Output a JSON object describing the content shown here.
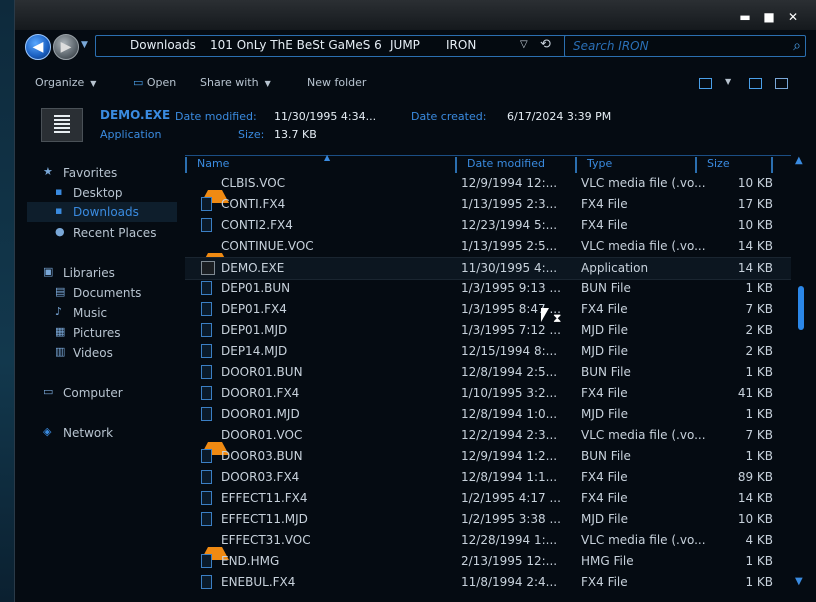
{
  "address": {
    "crumbs": [
      "Downloads",
      "101 OnLy ThE BeSt GaMeS 6",
      "JUMP",
      "IRON"
    ],
    "search_placeholder": "Search IRON"
  },
  "toolbar": {
    "organize": "Organize",
    "open": "Open",
    "share_with": "Share with",
    "new_folder": "New folder"
  },
  "details": {
    "name": "DEMO.EXE",
    "type": "Application",
    "date_modified_label": "Date modified:",
    "date_modified": "11/30/1995 4:34...",
    "date_created_label": "Date created:",
    "date_created": "6/17/2024 3:39 PM",
    "size_label": "Size:",
    "size": "13.7 KB"
  },
  "sidebar": {
    "favorites": "Favorites",
    "desktop": "Desktop",
    "downloads": "Downloads",
    "recent": "Recent Places",
    "libraries": "Libraries",
    "documents": "Documents",
    "music": "Music",
    "pictures": "Pictures",
    "videos": "Videos",
    "computer": "Computer",
    "network": "Network"
  },
  "columns": {
    "name": "Name",
    "date": "Date modified",
    "type": "Type",
    "size": "Size"
  },
  "files": [
    {
      "name": "CLBIS.VOC",
      "date": "12/9/1994 12:...",
      "type": "VLC media file (.vo...",
      "size": "10 KB",
      "icon": "vlc"
    },
    {
      "name": "CONTI.FX4",
      "date": "1/13/1995 2:3...",
      "type": "FX4 File",
      "size": "17 KB",
      "icon": "file"
    },
    {
      "name": "CONTI2.FX4",
      "date": "12/23/1994 5:...",
      "type": "FX4 File",
      "size": "10 KB",
      "icon": "file"
    },
    {
      "name": "CONTINUE.VOC",
      "date": "1/13/1995 2:5...",
      "type": "VLC media file (.vo...",
      "size": "14 KB",
      "icon": "vlc"
    },
    {
      "name": "DEMO.EXE",
      "date": "11/30/1995 4:...",
      "type": "Application",
      "size": "14 KB",
      "icon": "exe"
    },
    {
      "name": "DEP01.BUN",
      "date": "1/3/1995 9:13 ...",
      "type": "BUN File",
      "size": "1 KB",
      "icon": "file"
    },
    {
      "name": "DEP01.FX4",
      "date": "1/3/1995 8:47 ...",
      "type": "FX4 File",
      "size": "7 KB",
      "icon": "file"
    },
    {
      "name": "DEP01.MJD",
      "date": "1/3/1995 7:12 ...",
      "type": "MJD File",
      "size": "2 KB",
      "icon": "file"
    },
    {
      "name": "DEP14.MJD",
      "date": "12/15/1994 8:...",
      "type": "MJD File",
      "size": "2 KB",
      "icon": "file"
    },
    {
      "name": "DOOR01.BUN",
      "date": "12/8/1994 2:5...",
      "type": "BUN File",
      "size": "1 KB",
      "icon": "file"
    },
    {
      "name": "DOOR01.FX4",
      "date": "1/10/1995 3:2...",
      "type": "FX4 File",
      "size": "41 KB",
      "icon": "file"
    },
    {
      "name": "DOOR01.MJD",
      "date": "12/8/1994 1:0...",
      "type": "MJD File",
      "size": "1 KB",
      "icon": "file"
    },
    {
      "name": "DOOR01.VOC",
      "date": "12/2/1994 2:3...",
      "type": "VLC media file (.vo...",
      "size": "7 KB",
      "icon": "vlc"
    },
    {
      "name": "DOOR03.BUN",
      "date": "12/9/1994 1:2...",
      "type": "BUN File",
      "size": "1 KB",
      "icon": "file"
    },
    {
      "name": "DOOR03.FX4",
      "date": "12/8/1994 1:1...",
      "type": "FX4 File",
      "size": "89 KB",
      "icon": "file"
    },
    {
      "name": "EFFECT11.FX4",
      "date": "1/2/1995 4:17 ...",
      "type": "FX4 File",
      "size": "14 KB",
      "icon": "file"
    },
    {
      "name": "EFFECT11.MJD",
      "date": "1/2/1995 3:38 ...",
      "type": "MJD File",
      "size": "10 KB",
      "icon": "file"
    },
    {
      "name": "EFFECT31.VOC",
      "date": "12/28/1994 1:...",
      "type": "VLC media file (.vo...",
      "size": "4 KB",
      "icon": "vlc"
    },
    {
      "name": "END.HMG",
      "date": "2/13/1995 12:...",
      "type": "HMG File",
      "size": "1 KB",
      "icon": "file"
    },
    {
      "name": "ENEBUL.FX4",
      "date": "11/8/1994 2:4...",
      "type": "FX4 File",
      "size": "1 KB",
      "icon": "file"
    }
  ]
}
